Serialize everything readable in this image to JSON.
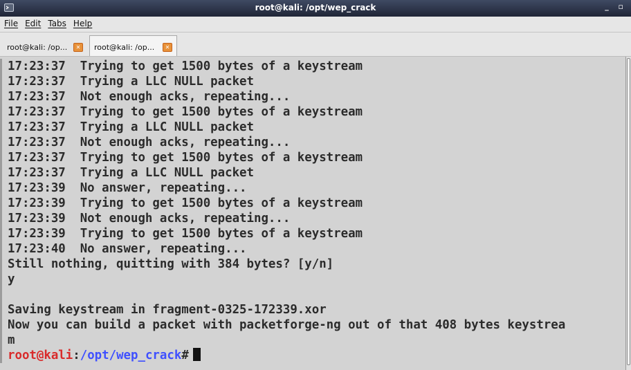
{
  "window": {
    "title": "root@kali: /opt/wep_crack",
    "controls": "_ ▫"
  },
  "menu": [
    "File",
    "Edit",
    "Tabs",
    "Help"
  ],
  "tabs": [
    {
      "label": "root@kali: /op...",
      "close": "✕",
      "active": false
    },
    {
      "label": "root@kali: /op...",
      "close": "✕",
      "active": true
    }
  ],
  "terminal": {
    "lines": [
      "17:23:37  Trying to get 1500 bytes of a keystream",
      "17:23:37  Trying a LLC NULL packet",
      "17:23:37  Not enough acks, repeating...",
      "17:23:37  Trying to get 1500 bytes of a keystream",
      "17:23:37  Trying a LLC NULL packet",
      "17:23:37  Not enough acks, repeating...",
      "17:23:37  Trying to get 1500 bytes of a keystream",
      "17:23:37  Trying a LLC NULL packet",
      "17:23:39  No answer, repeating...",
      "17:23:39  Trying to get 1500 bytes of a keystream",
      "17:23:39  Not enough acks, repeating...",
      "17:23:39  Trying to get 1500 bytes of a keystream",
      "17:23:40  No answer, repeating...",
      "Still nothing, quitting with 384 bytes? [y/n]",
      "y",
      "",
      "Saving keystream in fragment-0325-172339.xor",
      "Now you can build a packet with packetforge-ng out of that 408 bytes keystrea",
      "m"
    ],
    "prompt": {
      "user_host": "root@kali",
      "separator": ":",
      "path": "/opt/wep_crack",
      "symbol": "#"
    }
  },
  "colors": {
    "prompt_user": "#d92b2b",
    "prompt_path": "#3f50ff",
    "terminal_bg": "#d3d3d3",
    "terminal_fg": "#2b2b2b"
  }
}
